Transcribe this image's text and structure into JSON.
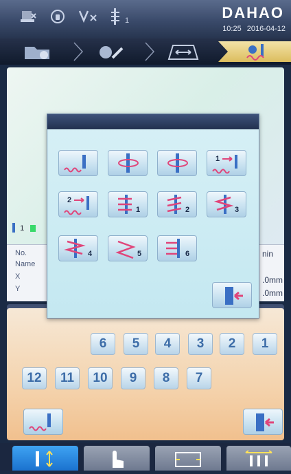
{
  "header": {
    "brand": "DAHAO",
    "time": "10:25",
    "date": "2016-04-12",
    "status_icons": [
      "machine-icon",
      "lock-icon",
      "thread-break-icon",
      "needle-select-icon"
    ],
    "needle_subscript": "1"
  },
  "breadcrumb": {
    "items": [
      "folder-pattern-icon",
      "pattern-edit-icon",
      "frame-move-icon",
      "embroider-needle-icon"
    ],
    "active_index": 3
  },
  "main": {
    "needle_indicator": "1",
    "info": {
      "labels": [
        "No.",
        "Name",
        "X",
        "Y"
      ],
      "values": [
        "nin",
        ".0mm",
        ".0mm"
      ]
    }
  },
  "popup": {
    "buttons": [
      {
        "icon": "stitch-needle-icon",
        "sub": ""
      },
      {
        "icon": "needle-rotate-icon",
        "sub": ""
      },
      {
        "icon": "needle-rotate-icon",
        "sub": ""
      },
      {
        "icon": "needle-move-icon",
        "sub": "1"
      },
      {
        "icon": "needle-move-icon",
        "sub": "2"
      },
      {
        "icon": "needle-bar-icon",
        "sub": "1"
      },
      {
        "icon": "needle-bar-icon",
        "sub": "2"
      },
      {
        "icon": "needle-bar-icon",
        "sub": "3"
      },
      {
        "icon": "needle-bar-icon",
        "sub": "4"
      },
      {
        "icon": "zigzag-icon",
        "sub": "5"
      },
      {
        "icon": "needle-bar-icon",
        "sub": "6"
      }
    ],
    "exit_icon": "exit-icon"
  },
  "needle_panel": {
    "row1": [
      "6",
      "5",
      "4",
      "3",
      "2",
      "1"
    ],
    "row2": [
      "12",
      "11",
      "10",
      "9",
      "8",
      "7"
    ],
    "stitch_icon": "stitch-needle-icon",
    "exit_icon": "exit-icon"
  },
  "tabs": [
    "needle-tab-icon",
    "manual-tab-icon",
    "frame-tab-icon",
    "multi-needle-tab-icon"
  ],
  "colors": {
    "accent": "#1b72cf",
    "number": "#3d6da8",
    "stitch_pink": "#e0457a",
    "needle_blue": "#3a6fc4"
  }
}
